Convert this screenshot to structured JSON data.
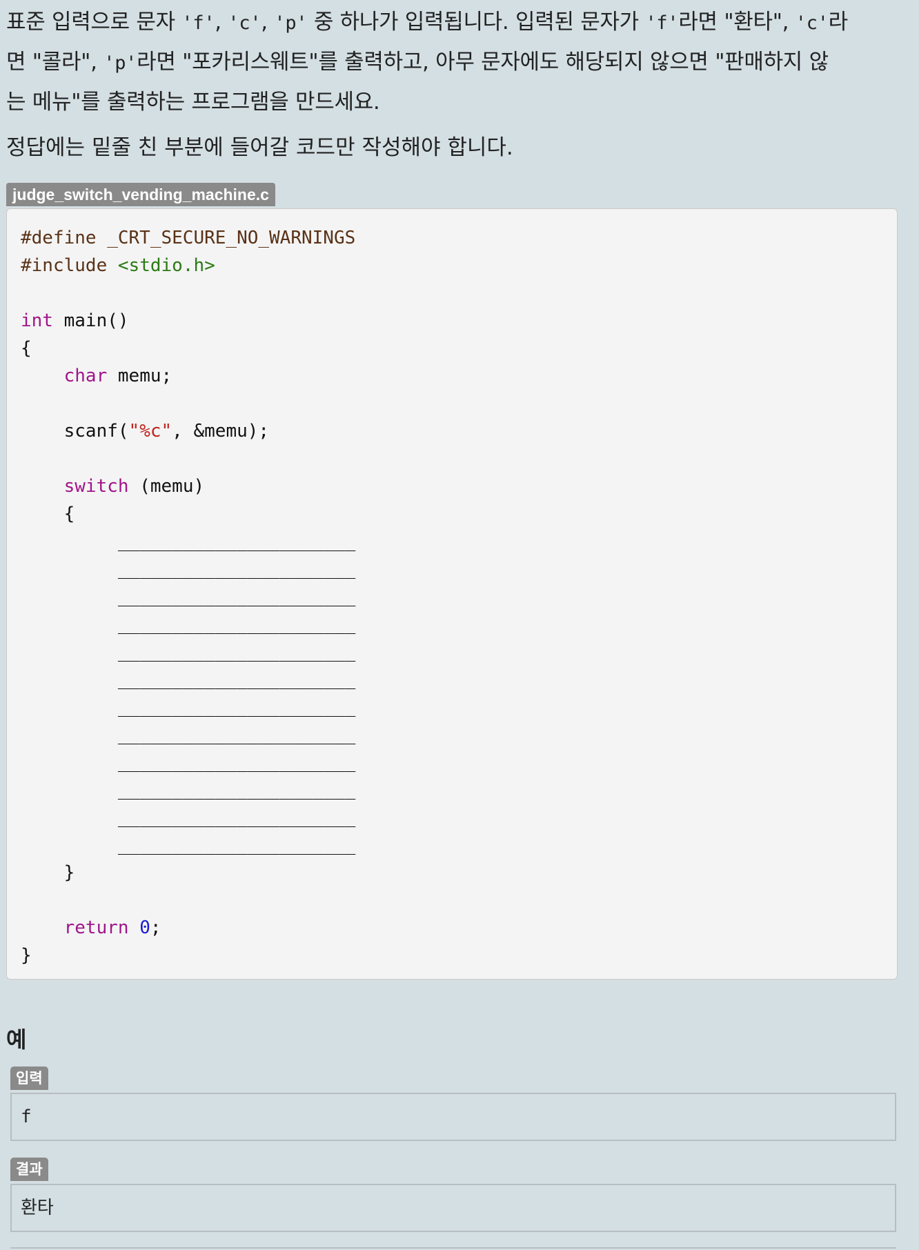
{
  "problem": {
    "line1": {
      "t1": "표준 입력으로 문자 ",
      "c_f": "'f'",
      "sep1": ", ",
      "c_c": "'c'",
      "sep2": ", ",
      "c_p": "'p'",
      "t2": " 중 하나가 입력됩니다. 입력된 문자가 ",
      "c_f2": "'f'",
      "t3": "라면 \"환타\", ",
      "c_c2": "'c'",
      "t4": "라"
    },
    "line2": {
      "t1": "면 \"콜라\", ",
      "c_p2": "'p'",
      "t2": "라면 \"포카리스웨트\"를 출력하고, 아무 문자에도 해당되지 않으면 \"판매하지  않"
    },
    "line3": "는  메뉴\"를 출력하는 프로그램을 만드세요.",
    "note": "정답에는 밑줄 친 부분에 들어갈 코드만 작성해야 합니다."
  },
  "file_tab": "judge_switch_vending_machine.c",
  "code": {
    "define_line": "#define _CRT_SECURE_NO_WARNINGS",
    "include_kw": "#include ",
    "include_file": "<stdio.h>",
    "int_kw": "int",
    "main_sig": " main()",
    "open_brace": "{",
    "char_kw": "char",
    "decl_rest": " memu;",
    "scanf_fn": "scanf(",
    "scanf_fmt": "\"%c\"",
    "scanf_rest": ", &memu);",
    "switch_kw": "switch",
    "switch_rest": " (memu)",
    "switch_open": "{",
    "blank_line": "______________________",
    "switch_close": "}",
    "return_kw": "return",
    "return_val": "0",
    "return_end": ";",
    "close_brace": "}"
  },
  "example": {
    "heading": "예",
    "input_label": "입력",
    "input_value": "f",
    "output_label": "결과",
    "output_value": "환타"
  }
}
